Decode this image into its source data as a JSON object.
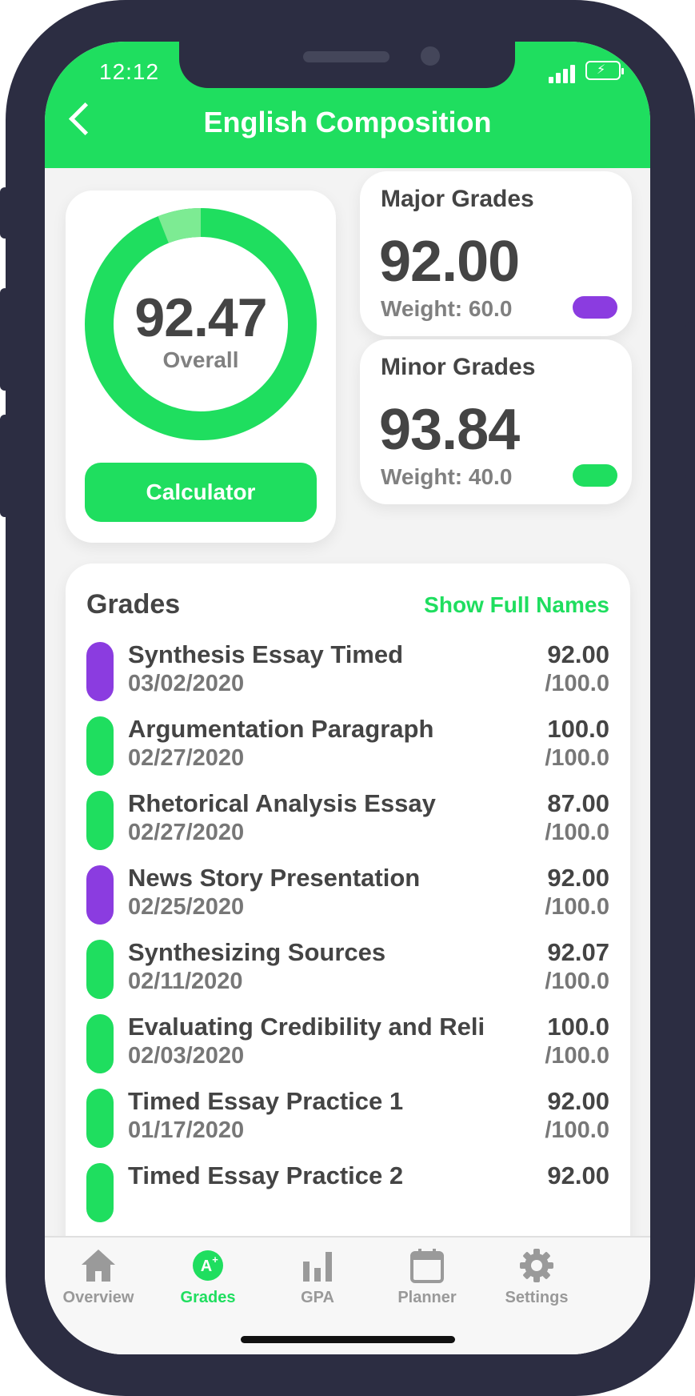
{
  "status_bar": {
    "time": "12:12"
  },
  "header": {
    "title": "English Composition",
    "back_icon": "chevron-left-icon"
  },
  "overall": {
    "value": "92.47",
    "label": "Overall",
    "calculator_label": "Calculator",
    "ring": {
      "major_fraction": 0.06,
      "major_color": "#7deb93",
      "minor_color": "#1fde5f"
    }
  },
  "major": {
    "title": "Major Grades",
    "value": "92.00",
    "weight": "Weight: 60.0",
    "color": "#8b3ce0"
  },
  "minor": {
    "title": "Minor Grades",
    "value": "93.84",
    "weight": "Weight: 40.0",
    "color": "#1fde5f"
  },
  "grades": {
    "heading": "Grades",
    "show_full_names": "Show Full Names",
    "items": [
      {
        "name": "Synthesis Essay Timed",
        "date": "03/02/2020",
        "score": "92.00",
        "total": "/100.0",
        "type": "major"
      },
      {
        "name": "Argumentation Paragraph",
        "date": "02/27/2020",
        "score": "100.0",
        "total": "/100.0",
        "type": "minor"
      },
      {
        "name": "Rhetorical Analysis Essay",
        "date": "02/27/2020",
        "score": "87.00",
        "total": "/100.0",
        "type": "minor"
      },
      {
        "name": "News Story Presentation",
        "date": "02/25/2020",
        "score": "92.00",
        "total": "/100.0",
        "type": "major"
      },
      {
        "name": "Synthesizing Sources",
        "date": "02/11/2020",
        "score": "92.07",
        "total": "/100.0",
        "type": "minor"
      },
      {
        "name": "Evaluating Credibility and Reli",
        "date": "02/03/2020",
        "score": "100.0",
        "total": "/100.0",
        "type": "minor"
      },
      {
        "name": "Timed Essay Practice 1",
        "date": "01/17/2020",
        "score": "92.00",
        "total": "/100.0",
        "type": "minor"
      },
      {
        "name": "Timed Essay Practice 2",
        "date": "",
        "score": "92.00",
        "total": "",
        "type": "minor"
      }
    ]
  },
  "tabs": [
    {
      "label": "Overview",
      "icon": "home-icon",
      "active": false
    },
    {
      "label": "Grades",
      "icon": "grade-badge-icon",
      "active": true
    },
    {
      "label": "GPA",
      "icon": "bar-chart-icon",
      "active": false
    },
    {
      "label": "Planner",
      "icon": "calendar-icon",
      "active": false
    },
    {
      "label": "Settings",
      "icon": "gear-icon",
      "active": false
    }
  ],
  "colors": {
    "accent": "#1fde5f",
    "major": "#8b3ce0",
    "text": "#444444",
    "muted": "#808080"
  }
}
